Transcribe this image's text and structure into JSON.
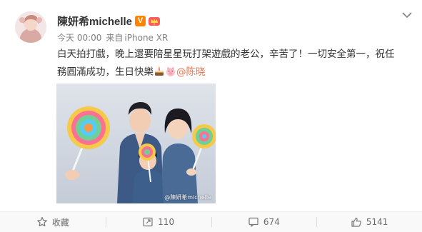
{
  "post": {
    "username": "陳妍希michelle",
    "verified_badge": "V",
    "timestamp": "今天 00:00",
    "source_prefix": "来自",
    "source_device": "iPhone XR",
    "text_line1": "白天拍打戲，晚上還要陪星星玩打架遊戲的老公，辛苦了！一切安全第一，祝任",
    "text_line2": "務圓滿成功，生日快樂",
    "mention": "@陈晓",
    "emojis": [
      "cake-icon",
      "pig-icon"
    ],
    "image_watermark": "@陳妍希michelle"
  },
  "actions": {
    "favorite_label": "收藏",
    "repost_count": "110",
    "comment_count": "674",
    "like_count": "5141"
  },
  "colors": {
    "text": "#333333",
    "meta": "#808080",
    "mention": "#eb7350",
    "verified": "#ff8200",
    "action_text": "#696969"
  }
}
